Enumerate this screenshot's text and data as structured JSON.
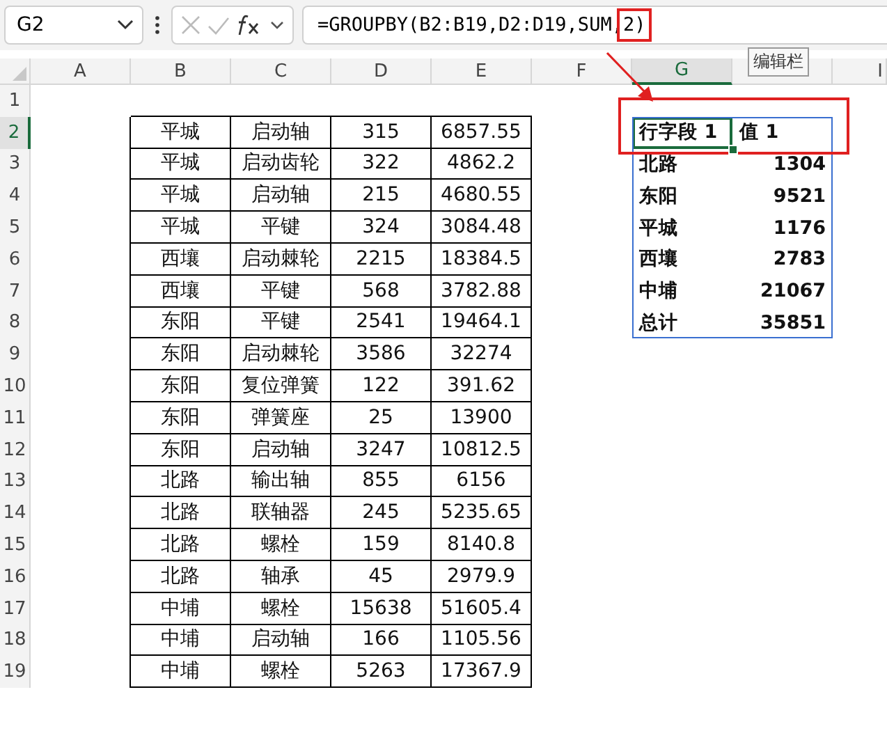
{
  "name_box": {
    "value": "G2"
  },
  "formula_bar": {
    "parts": [
      {
        "text": "=GROUPBY(B2:B19,D2:D19,SUM,",
        "highlighted": false
      },
      {
        "text": "2)",
        "highlighted": true
      }
    ]
  },
  "tooltip": "编辑栏",
  "columns": [
    {
      "label": "A",
      "selected": false
    },
    {
      "label": "B",
      "selected": false
    },
    {
      "label": "C",
      "selected": false
    },
    {
      "label": "D",
      "selected": false
    },
    {
      "label": "E",
      "selected": false
    },
    {
      "label": "F",
      "selected": false
    },
    {
      "label": "G",
      "selected": true
    },
    {
      "selected": false
    },
    {
      "label": "I",
      "selected": false
    }
  ],
  "rows": [
    {
      "label": "1",
      "selected": false
    },
    {
      "label": "2",
      "selected": true
    },
    {
      "label": "3",
      "selected": false
    },
    {
      "label": "4",
      "selected": false
    },
    {
      "label": "5",
      "selected": false
    },
    {
      "label": "6",
      "selected": false
    },
    {
      "label": "7",
      "selected": false
    },
    {
      "label": "8",
      "selected": false
    },
    {
      "label": "9",
      "selected": false
    },
    {
      "label": "10",
      "selected": false
    },
    {
      "label": "11",
      "selected": false
    },
    {
      "label": "12",
      "selected": false
    },
    {
      "label": "13",
      "selected": false
    },
    {
      "label": "14",
      "selected": false
    },
    {
      "label": "15",
      "selected": false
    },
    {
      "label": "16",
      "selected": false
    },
    {
      "label": "17",
      "selected": false
    },
    {
      "label": "18",
      "selected": false
    },
    {
      "label": "19",
      "selected": false
    }
  ],
  "table": {
    "rows": [
      [
        "平城",
        "启动轴",
        "315",
        "6857.55"
      ],
      [
        "平城",
        "启动齿轮",
        "322",
        "4862.2"
      ],
      [
        "平城",
        "启动轴",
        "215",
        "4680.55"
      ],
      [
        "平城",
        "平键",
        "324",
        "3084.48"
      ],
      [
        "西壤",
        "启动棘轮",
        "2215",
        "18384.5"
      ],
      [
        "西壤",
        "平键",
        "568",
        "3782.88"
      ],
      [
        "东阳",
        "平键",
        "2541",
        "19464.1"
      ],
      [
        "东阳",
        "启动棘轮",
        "3586",
        "32274"
      ],
      [
        "东阳",
        "复位弹簧",
        "122",
        "391.62"
      ],
      [
        "东阳",
        "弹簧座",
        "25",
        "13900"
      ],
      [
        "东阳",
        "启动轴",
        "3247",
        "10812.5"
      ],
      [
        "北路",
        "输出轴",
        "855",
        "6156"
      ],
      [
        "北路",
        "联轴器",
        "245",
        "5235.65"
      ],
      [
        "北路",
        "螺栓",
        "159",
        "8140.8"
      ],
      [
        "北路",
        "轴承",
        "45",
        "2979.9"
      ],
      [
        "中埔",
        "螺栓",
        "15638",
        "51605.4"
      ],
      [
        "中埔",
        "启动轴",
        "166",
        "1105.56"
      ],
      [
        "中埔",
        "螺栓",
        "5263",
        "17367.9"
      ]
    ]
  },
  "groupby_result": {
    "header": [
      "行字段 1",
      "值 1"
    ],
    "rows": [
      [
        "北路",
        "1304"
      ],
      [
        "东阳",
        "9521"
      ],
      [
        "平城",
        "1176"
      ],
      [
        "西壤",
        "2783"
      ],
      [
        "中埔",
        "21067"
      ],
      [
        "总计",
        "35851"
      ]
    ]
  }
}
